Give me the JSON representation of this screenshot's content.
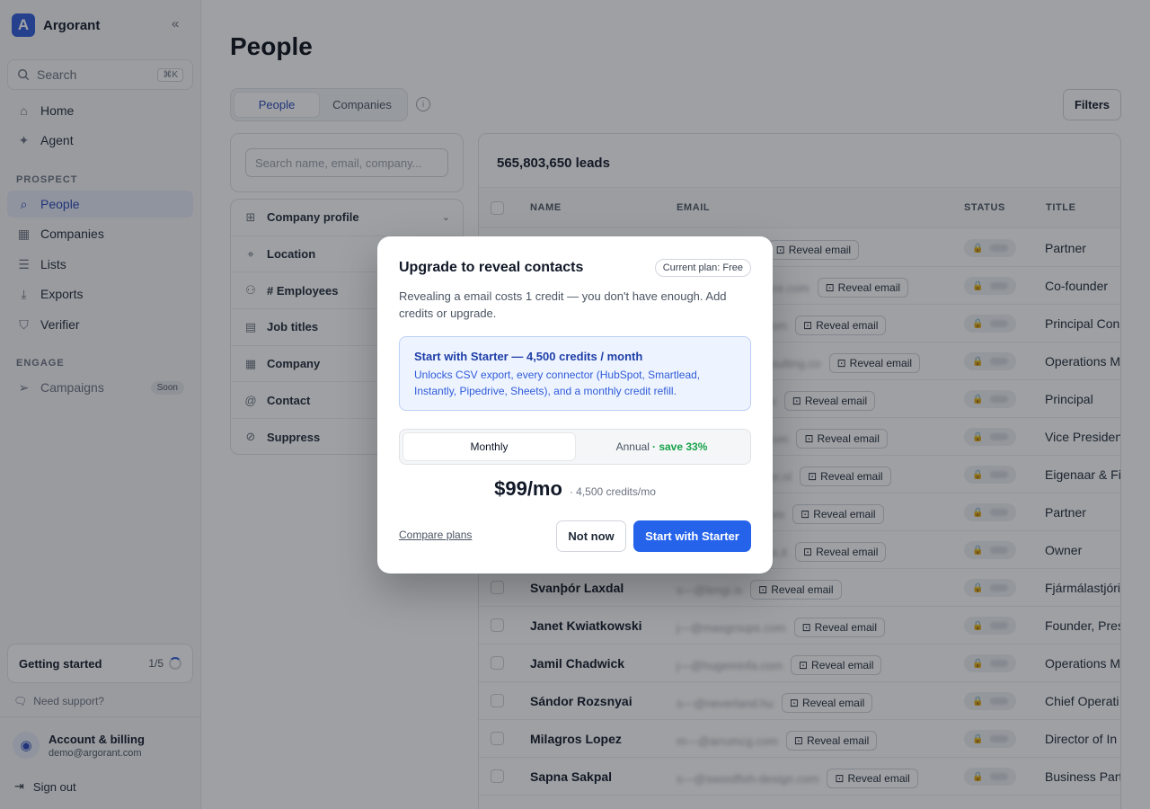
{
  "app": {
    "name": "Argorant",
    "logo_letter": "A",
    "accent": "#2f5bd9"
  },
  "sidebar": {
    "search": {
      "label": "Search",
      "shortcut": "⌘K"
    },
    "top_items": [
      {
        "label": "Home"
      },
      {
        "label": "Agent"
      }
    ],
    "prospect_label": "PROSPECT",
    "prospect_items": [
      {
        "label": "People"
      },
      {
        "label": "Companies"
      },
      {
        "label": "Lists"
      },
      {
        "label": "Exports"
      },
      {
        "label": "Verifier"
      }
    ],
    "engage_label": "ENGAGE",
    "engage_items": [
      {
        "label": "Campaigns",
        "badge": "Soon"
      }
    ],
    "getting_started": {
      "label": "Getting started",
      "progress": "1/5"
    },
    "support": "Need support?",
    "account": {
      "title": "Account & billing",
      "email": "demo@argorant.com"
    },
    "sign_out": "Sign out"
  },
  "main": {
    "title": "People",
    "tabs": [
      {
        "label": "People"
      },
      {
        "label": "Companies"
      }
    ],
    "filters_button": "Filters",
    "filter_search_placeholder": "Search name, email, company...",
    "filter_groups": [
      {
        "label": "Company profile"
      },
      {
        "label": "Location"
      },
      {
        "label": "# Employees"
      },
      {
        "label": "Job titles"
      },
      {
        "label": "Company"
      },
      {
        "label": "Contact"
      },
      {
        "label": "Suppress"
      }
    ],
    "leads_count": "565,803,650 leads",
    "columns": {
      "name": "NAME",
      "email": "EMAIL",
      "status": "STATUS",
      "title": "TITLE"
    },
    "reveal_label": "Reveal email",
    "rows": [
      {
        "name": "",
        "email": "s—@kemp.com",
        "title": "Partner"
      },
      {
        "name": "",
        "email": "j—@sandersalliance.com",
        "title": "Co-founder"
      },
      {
        "name": "",
        "email": "m—@marsdrion.com",
        "title": "Principal Con"
      },
      {
        "name": "",
        "email": "a—@northstarconsulting.co",
        "title": "Operations M"
      },
      {
        "name": "",
        "email": "d—@verdaink.com",
        "title": "Principal"
      },
      {
        "name": "",
        "email": "r—@zephyrlogic.com",
        "title": "Vice Presiden"
      },
      {
        "name": "",
        "email": "k—@devriesbeheer.nl",
        "title": "Eigenaar & Fi"
      },
      {
        "name": "",
        "email": "t—@hollowview.com",
        "title": "Partner"
      },
      {
        "name": "",
        "email": "l—@brightsolutions.it",
        "title": "Owner"
      },
      {
        "name": "Svanþór Laxdal",
        "email": "s—@lengi.is",
        "title": "Fjármálastjóri"
      },
      {
        "name": "Janet Kwiatkowski",
        "email": "j—@maxgroups.com",
        "title": "Founder, Pres"
      },
      {
        "name": "Jamil Chadwick",
        "email": "j—@hugeminfa.com",
        "title": "Operations M"
      },
      {
        "name": "Sándor Rozsnyai",
        "email": "s—@neverland.hu",
        "title": "Chief Operati"
      },
      {
        "name": "Milagros Lopez",
        "email": "m—@arrumcg.com",
        "title": "Director of In"
      },
      {
        "name": "Sapna Sakpal",
        "email": "s—@swordfish-design.com",
        "title": "Business Part"
      }
    ]
  },
  "modal": {
    "title": "Upgrade to reveal contacts",
    "plan_badge": "Current plan: Free",
    "description": "Revealing a email costs 1 credit — you don't have enough. Add credits or upgrade.",
    "starter_title": "Start with Starter — 4,500 credits / month",
    "starter_desc": "Unlocks CSV export, every connector (HubSpot, Smartlead, Instantly, Pipedrive, Sheets), and a monthly credit refill.",
    "billing": {
      "monthly": "Monthly",
      "annual": "Annual",
      "annual_save": "· save 33%"
    },
    "price": "$99/mo",
    "price_sub": "· 4,500 credits/mo",
    "compare_link": "Compare plans",
    "not_now": "Not now",
    "cta": "Start with Starter"
  }
}
